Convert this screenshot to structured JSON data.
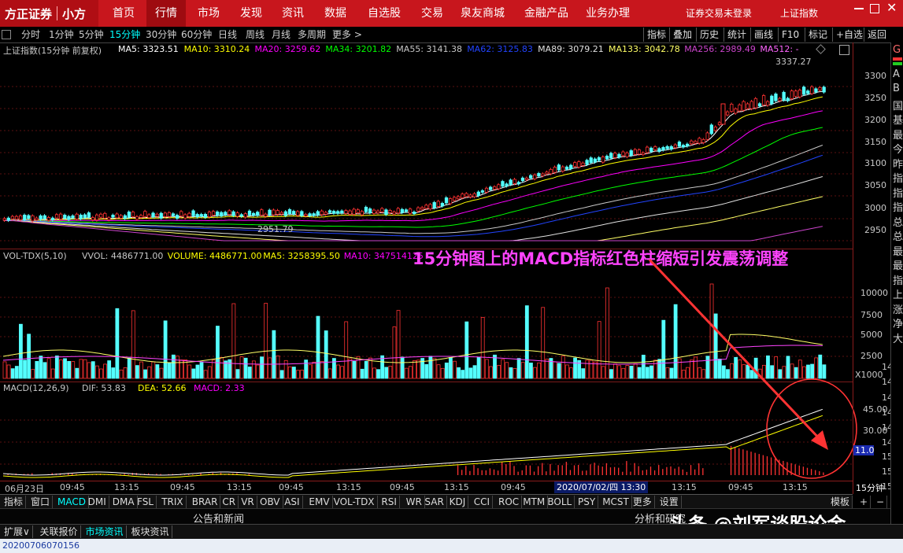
{
  "nav": {
    "brand": "方正证券",
    "app": "小方",
    "items": [
      "首页",
      "行情",
      "市场",
      "发现",
      "资讯",
      "数据",
      "自选股",
      "交易",
      "泉友商城",
      "金融产品",
      "业务办理"
    ],
    "active_index": 1,
    "right": [
      "证券交易未登录",
      "上证指数"
    ]
  },
  "toolbar": {
    "periods": [
      "分时",
      "1分钟",
      "5分钟",
      "15分钟",
      "30分钟",
      "60分钟",
      "日线",
      "周线",
      "月线",
      "多周期",
      "更多 >"
    ],
    "active_period_index": 3,
    "right": [
      "指标",
      "叠加",
      "历史",
      "统计",
      "画线",
      "F10",
      "标记",
      "+自选",
      "返回"
    ]
  },
  "main": {
    "title": "上证指数(15分钟 前复权)",
    "ma": [
      {
        "label": "MA5: 3323.51",
        "color": "#ffffff"
      },
      {
        "label": "MA10: 3310.24",
        "color": "#ffff00"
      },
      {
        "label": "MA20: 3259.62",
        "color": "#ff00ff"
      },
      {
        "label": "MA34: 3201.82",
        "color": "#00ff00"
      },
      {
        "label": "MA55: 3141.38",
        "color": "#c8c8c8"
      },
      {
        "label": "MA62: 3125.83",
        "color": "#2244ff"
      },
      {
        "label": "MA89: 3079.21",
        "color": "#e0e0e0"
      },
      {
        "label": "MA133: 3042.78",
        "color": "#ffff66"
      },
      {
        "label": "MA256: 2989.49",
        "color": "#cc44cc"
      },
      {
        "label": "MA512: -",
        "color": "#ff66ff"
      }
    ],
    "high_label": "3337.27",
    "low_label": "2951.79",
    "y_ticks": [
      "3300",
      "3250",
      "3200",
      "3150",
      "3100",
      "3050",
      "3000",
      "2950"
    ]
  },
  "volume": {
    "title": "VOL-TDX(5,10)",
    "items": [
      {
        "label": "VVOL: 4486771.00",
        "color": "#c8c8c8"
      },
      {
        "label": "VOLUME: 4486771.00",
        "color": "#ffff00"
      },
      {
        "label": "MA5: 3258395.50",
        "color": "#ffff00"
      },
      {
        "label": "MA10: 347514125",
        "color": "#ff00ff"
      }
    ],
    "y_ticks": [
      "10000",
      "7500",
      "5000",
      "2500"
    ],
    "unit": "X1000"
  },
  "macd": {
    "title": "MACD(12,26,9)",
    "items": [
      {
        "label": "DIF: 53.83",
        "color": "#c8c8c8"
      },
      {
        "label": "DEA: 52.66",
        "color": "#ffff00"
      },
      {
        "label": "MACD: 2.33",
        "color": "#ff00ff"
      }
    ],
    "y_ticks": [
      "45.00",
      "30.00"
    ],
    "current": "11.0"
  },
  "annotation": "15分钟图上的MACD指标红色柱缩短引发震荡调整",
  "time_axis": {
    "labels": [
      "06月23日",
      "09:45",
      "13:15",
      "09:45",
      "13:15",
      "09:45",
      "13:15",
      "09:45",
      "13:15",
      "09:45",
      "13:15",
      "09:45",
      "13:15",
      "09:45",
      "13:15"
    ],
    "cursor": "2020/07/02/四 13:30",
    "period": "15分钟"
  },
  "indicators": [
    "指标",
    "窗口",
    "MACD",
    "DMI",
    "DMA",
    "FSL",
    "TRIX",
    "BRAR",
    "CR",
    "VR",
    "OBV",
    "ASI",
    "EMV",
    "VOL-TDX",
    "RSI",
    "WR",
    "SAR",
    "KDJ",
    "CCI",
    "ROC",
    "MTM",
    "BOLL",
    "PSY",
    "MCST",
    "更多",
    "设置"
  ],
  "indicators_active": 2,
  "indicators_right": [
    "模板",
    "+",
    "−"
  ],
  "news": {
    "left": "公告和新闻",
    "right": "分析和研究"
  },
  "tabs": [
    "扩展∨",
    "关联报价",
    "市场资讯",
    "板块资讯"
  ],
  "tabs_active": 2,
  "watermark": "头条 @刘军谈股论金",
  "status": "20200706070156",
  "side_chars": [
    "G",
    "A",
    "B",
    "国",
    "基",
    "最",
    "今",
    "昨",
    "指",
    "指",
    "指",
    "总",
    "总",
    "最",
    "最",
    "指",
    "上",
    "涨",
    "净",
    "大"
  ],
  "right_small": [
    "14",
    "14",
    "14",
    "14",
    "14",
    "14",
    "15",
    "15",
    "15"
  ]
}
